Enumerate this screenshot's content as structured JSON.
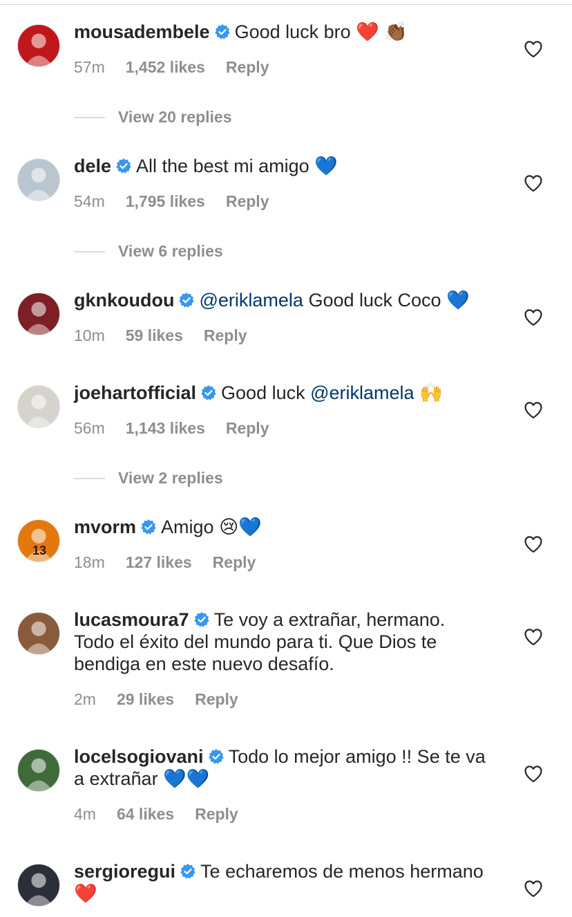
{
  "comments": [
    {
      "username": "mousadembele",
      "verified": true,
      "segments": [
        {
          "text": "Good luck bro "
        },
        {
          "text": "❤️",
          "cls": "heart-emoji"
        },
        {
          "text": " 👏🏾"
        }
      ],
      "time": "57m",
      "likes": "1,452 likes",
      "reply": "Reply",
      "view_replies": "View 20 replies",
      "avatar_color": "#c0171b"
    },
    {
      "username": "dele",
      "verified": true,
      "segments": [
        {
          "text": "All the best mi amigo "
        },
        {
          "text": "💙",
          "cls": "blue-heart"
        }
      ],
      "time": "54m",
      "likes": "1,795 likes",
      "reply": "Reply",
      "view_replies": "View 6 replies",
      "avatar_color": "#b9c6cf"
    },
    {
      "username": "gknkoudou",
      "verified": true,
      "segments": [
        {
          "text": "@eriklamela",
          "cls": "mention"
        },
        {
          "text": " Good luck Coco "
        },
        {
          "text": "💙",
          "cls": "blue-heart"
        }
      ],
      "time": "10m",
      "likes": "59 likes",
      "reply": "Reply",
      "view_replies": null,
      "avatar_color": "#7d1f24"
    },
    {
      "username": "joehartofficial",
      "verified": true,
      "segments": [
        {
          "text": "Good luck "
        },
        {
          "text": "@eriklamela",
          "cls": "mention"
        },
        {
          "text": " 🙌"
        }
      ],
      "time": "56m",
      "likes": "1,143 likes",
      "reply": "Reply",
      "view_replies": "View 2 replies",
      "avatar_color": "#d6d2cc"
    },
    {
      "username": "mvorm",
      "verified": true,
      "segments": [
        {
          "text": "Amigo 😢"
        },
        {
          "text": "💙",
          "cls": "blue-heart"
        }
      ],
      "time": "18m",
      "likes": "127 likes",
      "reply": "Reply",
      "view_replies": null,
      "avatar_color": "#e5770f",
      "avatar_text": "13"
    },
    {
      "username": "lucasmoura7",
      "verified": true,
      "segments": [
        {
          "text": "Te voy a extrañar, hermano. Todo el éxito del mundo para ti. Que Dios te bendiga en este nuevo desafío."
        }
      ],
      "time": "2m",
      "likes": "29 likes",
      "reply": "Reply",
      "view_replies": null,
      "avatar_color": "#8a5a3c"
    },
    {
      "username": "locelsogiovani",
      "verified": true,
      "segments": [
        {
          "text": "Todo lo mejor amigo !! Se te va a extrañar "
        },
        {
          "text": "💙💙",
          "cls": "blue-heart"
        }
      ],
      "time": "4m",
      "likes": "64 likes",
      "reply": "Reply",
      "view_replies": null,
      "avatar_color": "#3f6a3a"
    },
    {
      "username": "sergioregui",
      "verified": true,
      "segments": [
        {
          "text": "Te echaremos de menos hermano "
        },
        {
          "text": "❤️",
          "cls": "heart-emoji"
        }
      ],
      "time": null,
      "likes": null,
      "reply": null,
      "view_replies": null,
      "avatar_color": "#2a2f3a"
    }
  ],
  "colors": {
    "muted": "#8e8e8e",
    "mention": "#00376b",
    "verified": "#3897f0"
  }
}
